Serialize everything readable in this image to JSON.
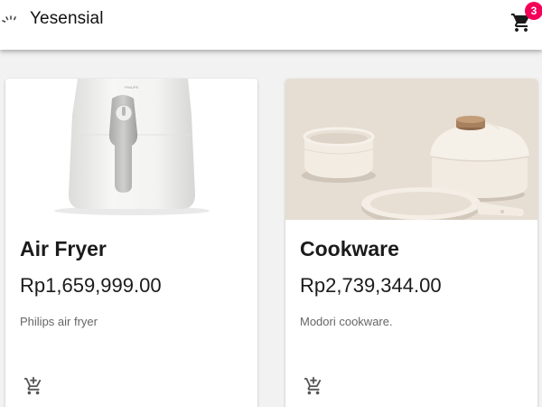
{
  "header": {
    "brand": "Yesensial",
    "logo_icon": "loading-spinner-icon",
    "cart_icon": "shopping-cart-icon",
    "cart_count": "3",
    "badge_color": "#f50057"
  },
  "products": [
    {
      "name": "Air Fryer",
      "price": "Rp1,659,999.00",
      "description": "Philips air fryer",
      "image": "air-fryer-image",
      "action_icon": "add-shopping-cart-icon"
    },
    {
      "name": "Cookware",
      "price": "Rp2,739,344.00",
      "description": "Modori cookware.",
      "image": "cookware-image",
      "action_icon": "add-shopping-cart-icon"
    }
  ]
}
